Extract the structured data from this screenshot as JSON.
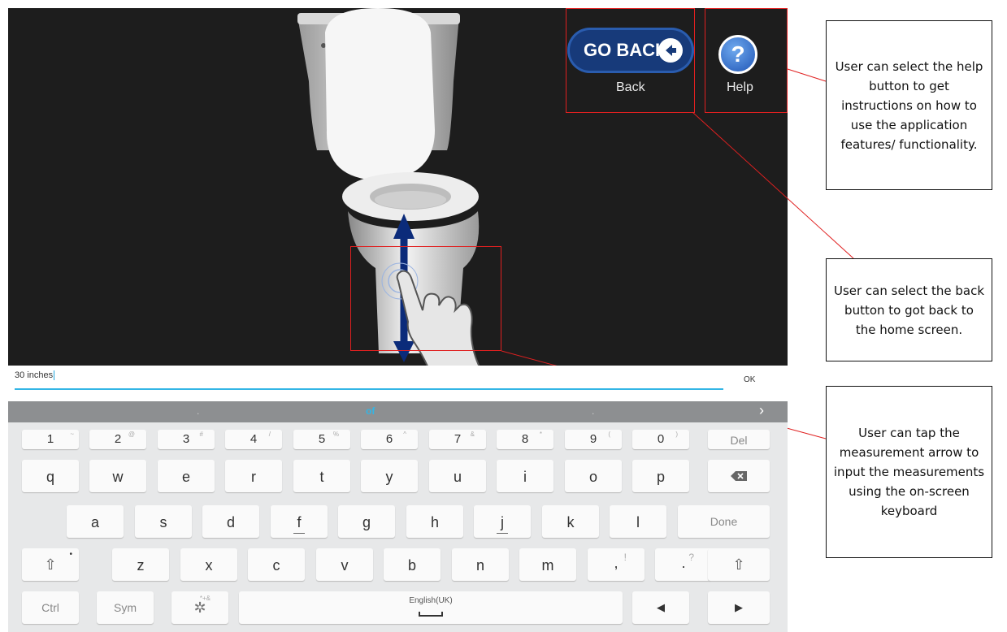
{
  "top_buttons": {
    "go_back_label": "GO BACK",
    "back_caption": "Back",
    "help_symbol": "?",
    "help_caption": "Help"
  },
  "input": {
    "value": "30 inches",
    "ok_label": "OK"
  },
  "suggestion_bar": {
    "items": [
      ".",
      "of",
      "."
    ],
    "more": "›"
  },
  "keyboard": {
    "number_row": [
      {
        "label": "1",
        "sup": "~"
      },
      {
        "label": "2",
        "sup": "@"
      },
      {
        "label": "3",
        "sup": "#"
      },
      {
        "label": "4",
        "sup": "/"
      },
      {
        "label": "5",
        "sup": "%"
      },
      {
        "label": "6",
        "sup": "^"
      },
      {
        "label": "7",
        "sup": "&"
      },
      {
        "label": "8",
        "sup": "*"
      },
      {
        "label": "9",
        "sup": "("
      },
      {
        "label": "0",
        "sup": ")"
      }
    ],
    "del_label": "Del",
    "row_q": [
      "q",
      "w",
      "e",
      "r",
      "t",
      "y",
      "u",
      "i",
      "o",
      "p"
    ],
    "row_a": [
      "a",
      "s",
      "d",
      "f",
      "g",
      "h",
      "j",
      "k",
      "l"
    ],
    "done_label": "Done",
    "row_z": [
      "z",
      "x",
      "c",
      "v",
      "b",
      "n",
      "m"
    ],
    "comma": {
      "label": ",",
      "sup": "!"
    },
    "period": {
      "label": ".",
      "sup": "?"
    },
    "shift_symbol": "⇧",
    "ctrl_label": "Ctrl",
    "sym_label": "Sym",
    "settings_sup": "*+&",
    "language_label": "English(UK)",
    "left_arrow": "◀",
    "right_arrow": "▶"
  },
  "annotations": {
    "help": "User can select the help button to get instructions on how to use the application features/ functionality.",
    "back": "User can select the back button to got back to the home screen.",
    "measure": "User can tap the measurement arrow to input the measurements using the on-screen keyboard"
  },
  "colors": {
    "screen_bg": "#1d1d1d",
    "go_back_bg": "#173a7a",
    "help_blue": "#1f55b6",
    "annotation_red": "#e02020",
    "input_accent": "#33b5e5",
    "measure_arrow": "#0b2b7a"
  },
  "icons": [
    "left-arrow-icon",
    "help-icon",
    "toilet-illustration",
    "measurement-arrow",
    "hand-pointer-icon",
    "backspace-icon",
    "shift-icon",
    "gear-icon",
    "space-icon",
    "left-arrow-key-icon",
    "right-arrow-key-icon"
  ]
}
